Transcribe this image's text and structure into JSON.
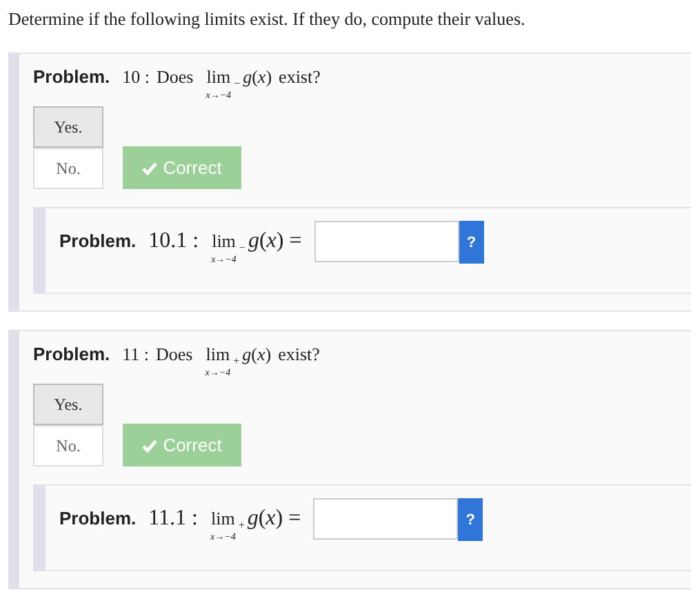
{
  "instructions": "Determine if the following limits exist. If they do, compute their values.",
  "problems": [
    {
      "label": "Problem.",
      "number": "10 :",
      "before": "Does",
      "lim": "lim",
      "under": "x→−4",
      "side": "−",
      "expr": "*g*(*x*)",
      "after": "exist?",
      "choices": [
        {
          "label": "Yes.",
          "selected": true
        },
        {
          "label": "No.",
          "selected": false
        }
      ],
      "feedback": {
        "kind": "correct",
        "text": "Correct"
      },
      "sub": {
        "label": "Problem.",
        "number": "10.1 :",
        "lim": "lim",
        "under": "x→−4",
        "side": "−",
        "expr": "*g*(*x*) =",
        "help": "?"
      }
    },
    {
      "label": "Problem.",
      "number": "11 :",
      "before": "Does",
      "lim": "lim",
      "under": "x→−4",
      "side": "+",
      "expr": "*g*(*x*)",
      "after": "exist?",
      "choices": [
        {
          "label": "Yes.",
          "selected": true
        },
        {
          "label": "No.",
          "selected": false
        }
      ],
      "feedback": {
        "kind": "correct",
        "text": "Correct"
      },
      "sub": {
        "label": "Problem.",
        "number": "11.1 :",
        "lim": "lim",
        "under": "x→−4",
        "side": "+",
        "expr": "*g*(*x*) =",
        "help": "?"
      }
    }
  ]
}
